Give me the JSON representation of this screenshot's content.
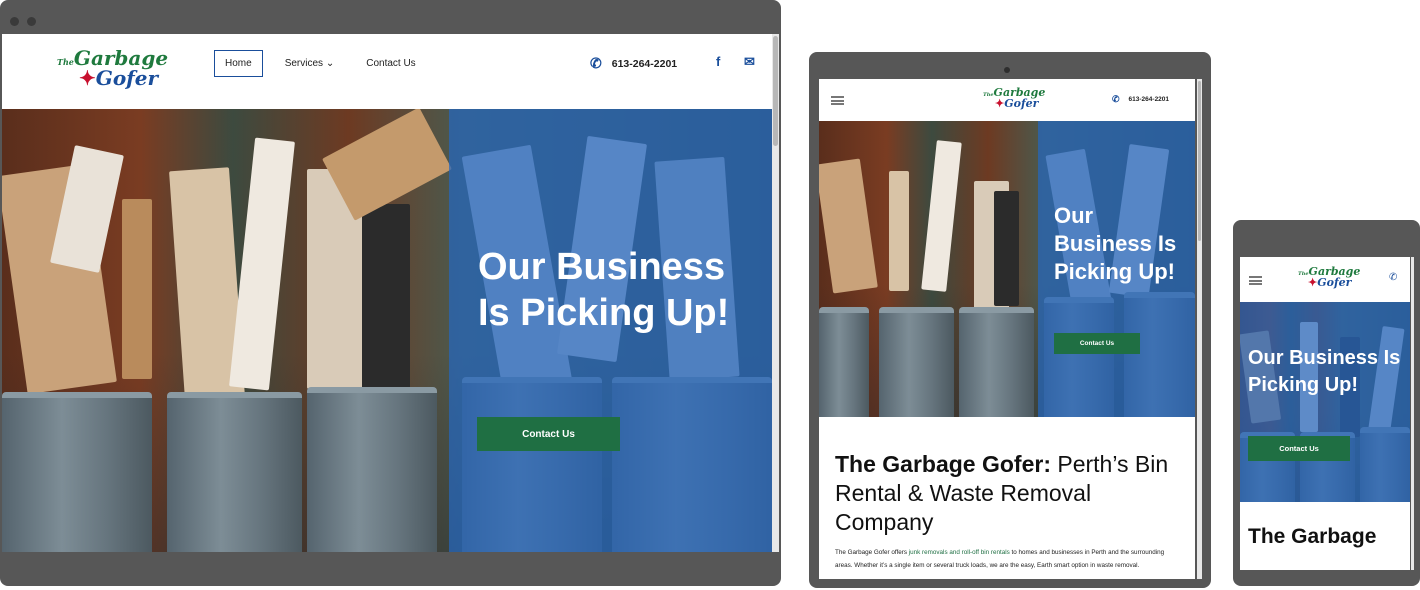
{
  "brand": {
    "logo_line1": "Garbage",
    "logo_line2": "Gofer",
    "logo_prefix": "The"
  },
  "nav": {
    "home": "Home",
    "services": "Services",
    "contact": "Contact Us",
    "chevron": "⌄"
  },
  "contact": {
    "phone": "613-264-2201",
    "phone_icon": "phone-icon",
    "facebook_glyph": "f",
    "email_glyph": "✉"
  },
  "hero": {
    "title": "Our Business Is Picking Up!",
    "cta": "Contact Us"
  },
  "intro": {
    "heading_bold": "The Garbage Gofer:",
    "heading_rest": " Perth’s Bin Rental & Waste Removal Company",
    "body_start": "The Garbage Gofer offers ",
    "body_link": "junk removals and roll-off bin rentals",
    "body_end": " to homes and businesses in Perth and the surrounding areas. Whether it’s a single item or several truck loads, we are the easy, Earth smart option in waste removal.",
    "mobile_heading": "The Garbage"
  },
  "colors": {
    "brand_green": "#1f6f43",
    "brand_blue": "#1a4e9b",
    "overlay_blue": "#2666be",
    "frame_gray": "#575757"
  }
}
